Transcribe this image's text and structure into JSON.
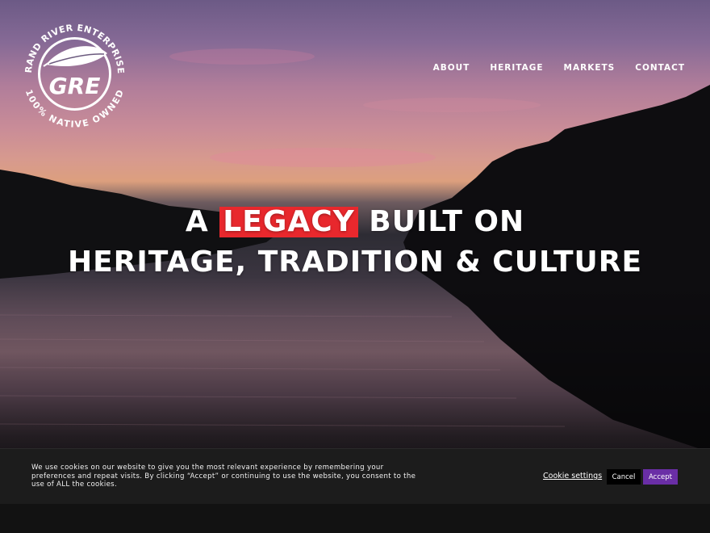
{
  "logo": {
    "top_text": "GRAND RIVER ENTERPRISES",
    "bottom_text": "100% NATIVE OWNED",
    "monogram": "GRE",
    "icon": "feather-icon"
  },
  "nav": {
    "items": [
      {
        "label": "ABOUT"
      },
      {
        "label": "HERITAGE"
      },
      {
        "label": "MARKETS"
      },
      {
        "label": "CONTACT"
      }
    ]
  },
  "hero": {
    "line1_prefix": "A",
    "line1_highlight": "LEGACY",
    "line1_suffix": "BUILT ON",
    "line2": "HERITAGE, TRADITION & CULTURE",
    "highlight_color": "#e8282d"
  },
  "cookie": {
    "message": "We use cookies on our website to give you the most relevant experience by remembering your preferences and repeat visits. By clicking “Accept” or continuing to use the website, you consent to the use of ALL the cookies.",
    "settings_label": "Cookie settings",
    "cancel_label": "Cancel",
    "accept_label": "Accept",
    "accept_color": "#6a2ea6"
  }
}
